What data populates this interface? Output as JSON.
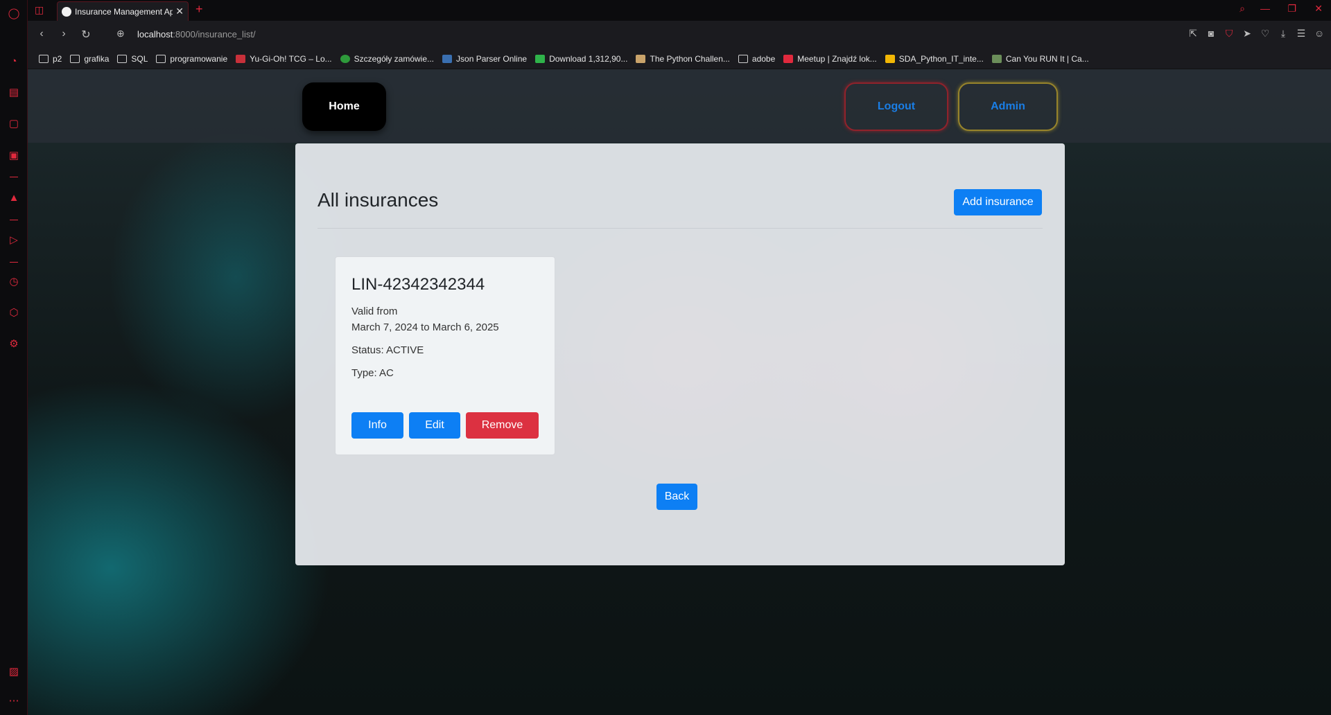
{
  "browser": {
    "tab_title": "Insurance Management Ap",
    "new_tab": "+",
    "close": "✕",
    "url_host": "localhost",
    "url_path": ":8000/insurance_list/",
    "bookmarks": [
      "p2",
      "grafika",
      "SQL",
      "programowanie",
      "Yu-Gi-Oh! TCG – Lo...",
      "Szczegóły zamówie...",
      "Json Parser Online",
      "Download 1,312,90...",
      "The Python Challen...",
      "adobe",
      "Meetup | Znajdź lok...",
      "SDA_Python_IT_inte...",
      "Can You RUN It | Ca..."
    ]
  },
  "nav": {
    "home": "Home",
    "logout": "Logout",
    "admin": "Admin"
  },
  "page": {
    "title": "All insurances",
    "add_button": "Add insurance",
    "back_button": "Back"
  },
  "insurances": [
    {
      "number": "LIN-42342342344",
      "valid_from_label": "Valid from",
      "valid_range": "March 7, 2024 to March 6, 2025",
      "status": "Status: ACTIVE",
      "type": "Type: AC",
      "info_label": "Info",
      "edit_label": "Edit",
      "remove_label": "Remove"
    }
  ],
  "colors": {
    "primary": "#0d7ff4",
    "danger": "#dc3141",
    "opera_accent": "#e0293d"
  }
}
